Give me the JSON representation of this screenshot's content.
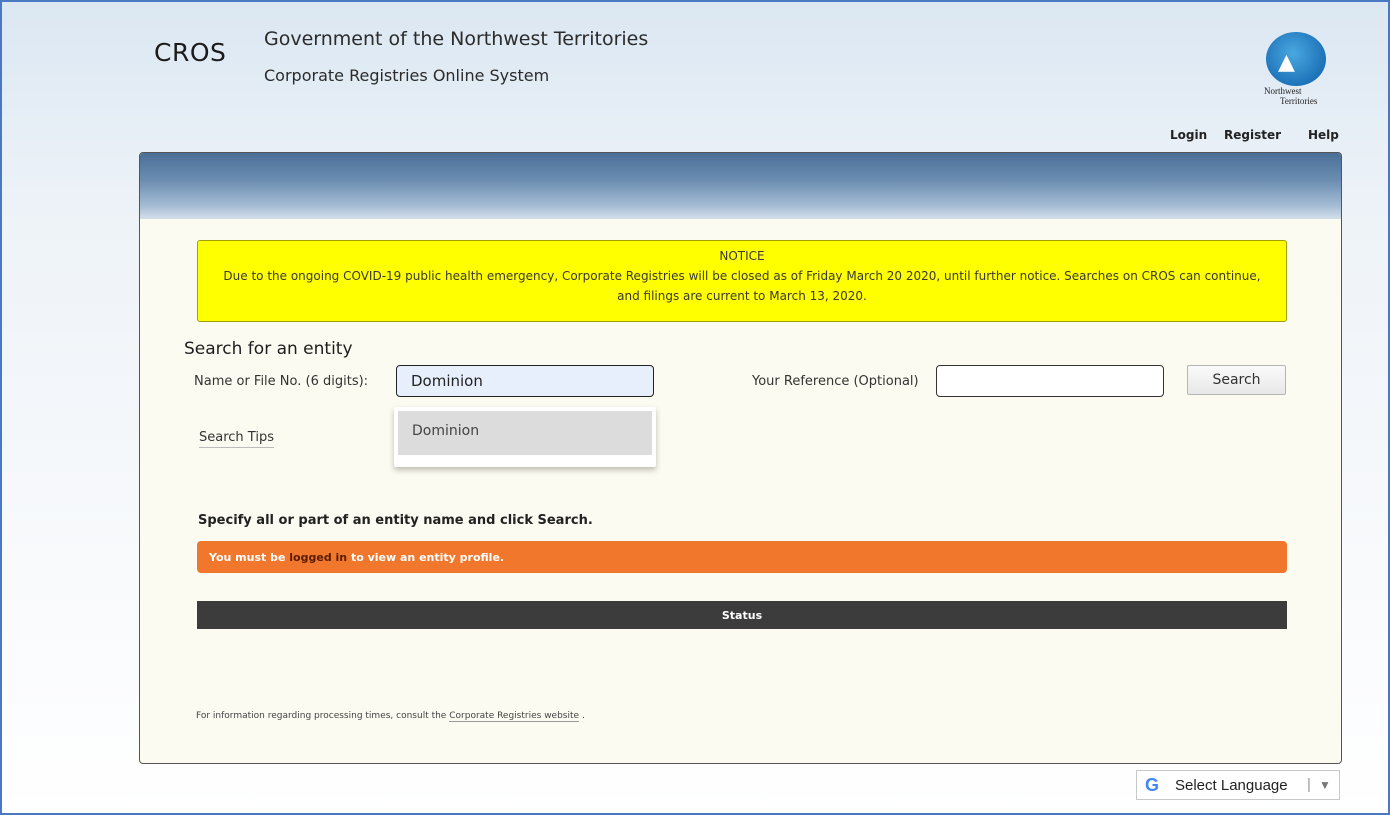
{
  "header": {
    "brand": "CROS",
    "gov_title": "Government of the Northwest Territories",
    "system_title": "Corporate Registries Online System",
    "logo_line1": "Northwest",
    "logo_line2": "Territories"
  },
  "nav": {
    "login": "Login",
    "register": "Register",
    "help": "Help"
  },
  "notice": {
    "title": "NOTICE",
    "body": "Due to the ongoing COVID-19 public health emergency, Corporate Registries will be closed as of Friday March 20 2020, until further notice. Searches on CROS can continue, and filings are current to March 13, 2020."
  },
  "search": {
    "title": "Search for an entity",
    "name_label": "Name or File No. (6 digits):",
    "name_value": "Dominion",
    "suggestions": [
      "Dominion"
    ],
    "tips_label": "Search Tips",
    "reference_label": "Your Reference (Optional)",
    "reference_value": "",
    "button_label": "Search"
  },
  "results": {
    "instruction": "Specify all or part of an entity name and click Search.",
    "alert_prefix": "You must be",
    "alert_link": "logged in",
    "alert_suffix": "to view an entity profile.",
    "status_header": "Status"
  },
  "footer": {
    "text": "For information regarding processing times, consult the",
    "link": "Corporate Registries website",
    "end": "."
  },
  "language": {
    "label": "Select Language"
  },
  "colors": {
    "notice_bg": "#ffff00",
    "alert_bg": "#f0772c",
    "status_bar": "#3c3c3c",
    "header_band": "#4a6f98"
  }
}
